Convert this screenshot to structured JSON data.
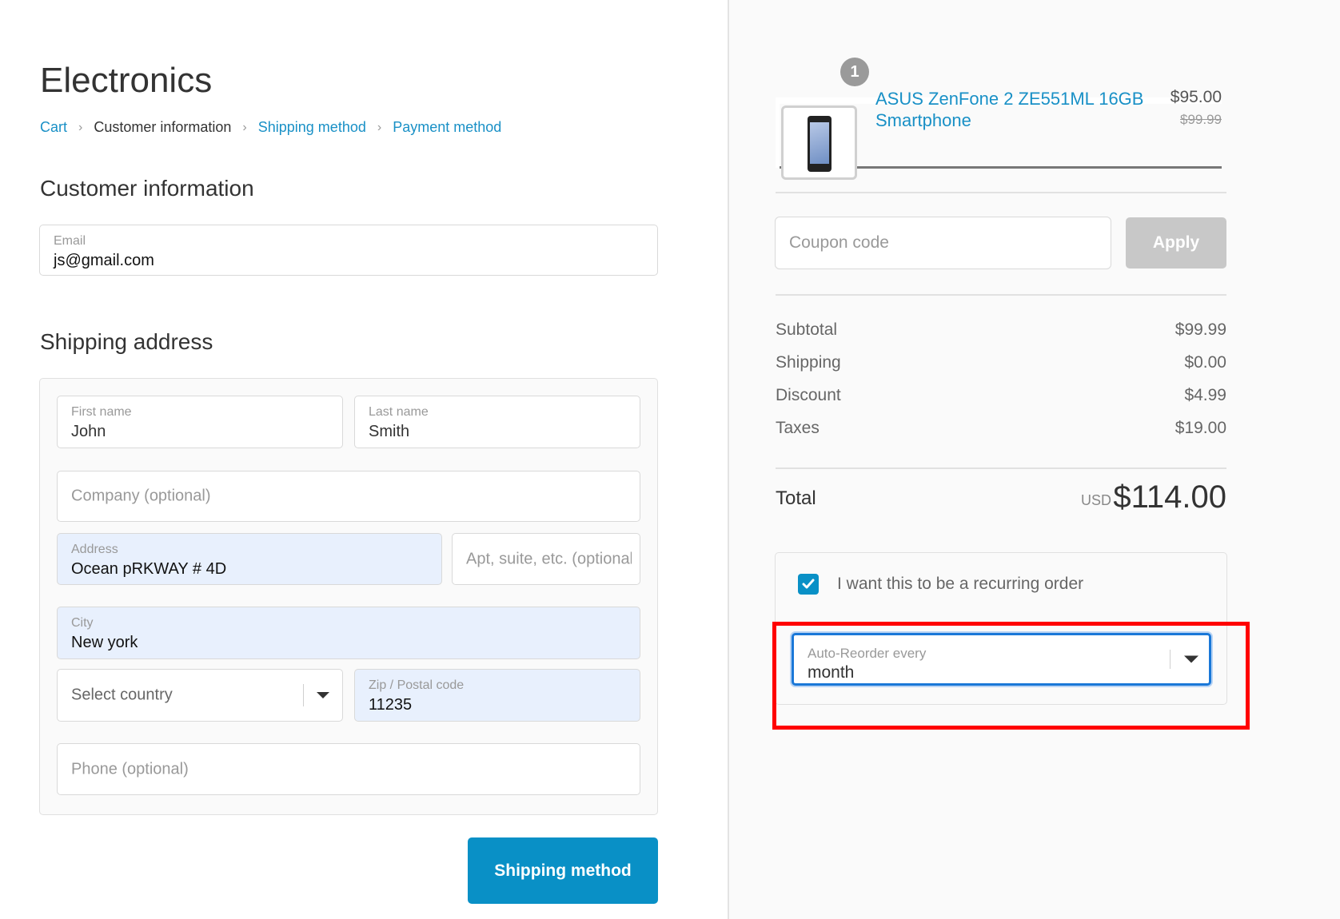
{
  "store": {
    "title": "Electronics"
  },
  "breadcrumb": [
    {
      "label": "Cart",
      "current": false
    },
    {
      "label": "Customer information",
      "current": true
    },
    {
      "label": "Shipping method",
      "current": false
    },
    {
      "label": "Payment method",
      "current": false
    }
  ],
  "customer": {
    "section_title": "Customer information",
    "email": {
      "label": "Email",
      "value": "js@gmail.com"
    }
  },
  "shipping": {
    "section_title": "Shipping address",
    "first_name": {
      "label": "First name",
      "value": "John"
    },
    "last_name": {
      "label": "Last name",
      "value": "Smith"
    },
    "company": {
      "placeholder": "Company (optional)"
    },
    "address": {
      "label": "Address",
      "value": "Ocean pRKWAY # 4D"
    },
    "apt": {
      "placeholder": "Apt, suite, etc. (optional)"
    },
    "city": {
      "label": "City",
      "value": "New york"
    },
    "country": {
      "placeholder": "Select country"
    },
    "zip": {
      "label": "Zip / Postal code",
      "value": "11235"
    },
    "phone": {
      "placeholder": "Phone (optional)"
    },
    "continue_button": "Shipping method"
  },
  "order": {
    "product": {
      "name": "ASUS ZenFone 2 ZE551ML 16GB Smartphone",
      "quantity": "1",
      "price": "$95.00",
      "original_price": "$99.99"
    },
    "coupon": {
      "placeholder": "Coupon code",
      "apply_label": "Apply"
    },
    "summary": [
      {
        "label": "Subtotal",
        "value": "$99.99"
      },
      {
        "label": "Shipping",
        "value": "$0.00"
      },
      {
        "label": "Discount",
        "value": "$4.99"
      },
      {
        "label": "Taxes",
        "value": "$19.00"
      }
    ],
    "total": {
      "label": "Total",
      "currency": "USD",
      "value": "$114.00"
    },
    "recurring": {
      "checkbox_label": "I want this to be a recurring order",
      "checked": true,
      "reorder_label": "Auto-Reorder every",
      "reorder_value": "month"
    }
  },
  "colors": {
    "accent": "#1990c6",
    "button": "#0990c6",
    "highlight": "#ff0000",
    "focus": "#1a78d8",
    "autofill": "#e8f0fd"
  }
}
